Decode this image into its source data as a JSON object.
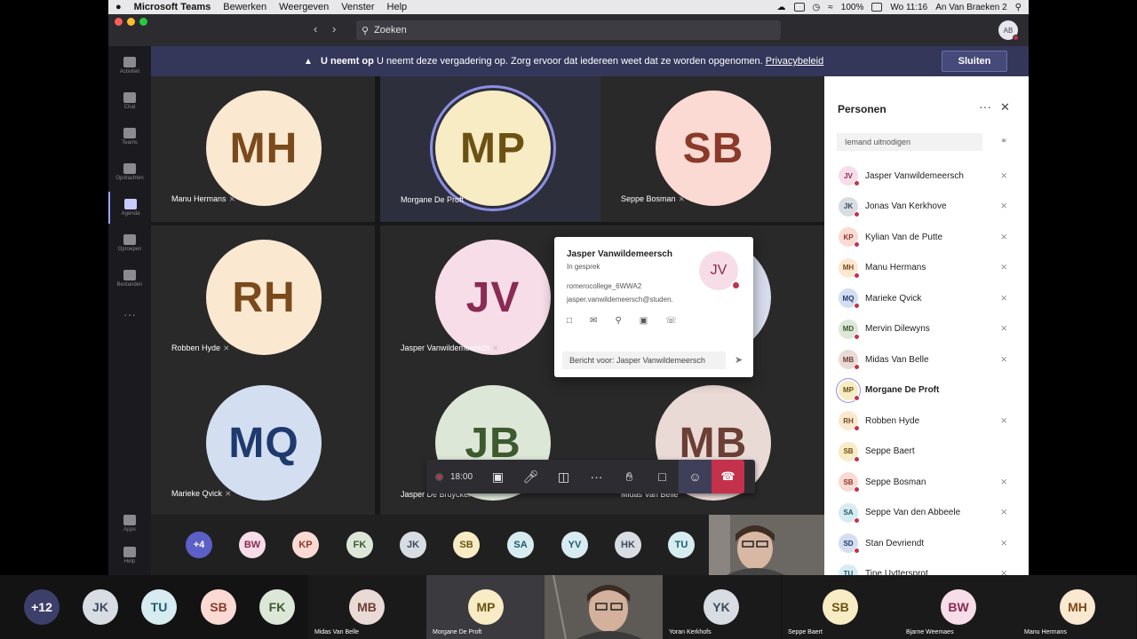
{
  "menubar": {
    "app": "Microsoft Teams",
    "menus": [
      "Bewerken",
      "Weergeven",
      "Venster",
      "Help"
    ],
    "battery": "100%",
    "clock": "Wo 11:16",
    "user": "An Van Braeken 2"
  },
  "titlebar": {
    "search_placeholder": "Zoeken",
    "me_initials": "AB"
  },
  "rail": [
    {
      "label": "Activiteit",
      "icon": "bell-icon"
    },
    {
      "label": "Chat",
      "icon": "chat-icon"
    },
    {
      "label": "Teams",
      "icon": "teams-icon"
    },
    {
      "label": "Opdrachten",
      "icon": "assignments-icon"
    },
    {
      "label": "Agenda",
      "icon": "calendar-icon"
    },
    {
      "label": "Oproepen",
      "icon": "phone-icon"
    },
    {
      "label": "Bestanden",
      "icon": "files-icon"
    },
    {
      "label": "Apps",
      "icon": "apps-icon"
    },
    {
      "label": "Help",
      "icon": "help-icon"
    }
  ],
  "banner": {
    "bold": "U neemt op",
    "text": "U neemt deze vergadering op. Zorg ervoor dat iedereen weet dat ze worden opgenomen.",
    "link": "Privacybeleid",
    "button": "Sluiten"
  },
  "grid": [
    {
      "initials": "MH",
      "name": "Manu Hermans",
      "bg": "#fbe8d0",
      "fg": "#7a4a1c"
    },
    {
      "initials": "MP",
      "name": "Morgane De Proft",
      "bg": "#f7ecc4",
      "fg": "#6b5213"
    },
    {
      "initials": "SB",
      "name": "Seppe Bosman",
      "bg": "#fadad2",
      "fg": "#8a3a2a"
    },
    {
      "initials": "RH",
      "name": "Robben Hyde",
      "bg": "#fbe8d0",
      "fg": "#7a4a1c"
    },
    {
      "initials": "JV",
      "name": "Jasper Vanwildemeersch",
      "bg": "#f6dde8",
      "fg": "#8a2a55"
    },
    {
      "initials": "",
      "name": "",
      "bg": "#d8dbeb",
      "fg": "#333"
    },
    {
      "initials": "MQ",
      "name": "Marieke Qvick",
      "bg": "#d3dff1",
      "fg": "#1e3a6e"
    },
    {
      "initials": "JB",
      "name": "Jasper De Bruycker",
      "bg": "#dde7d8",
      "fg": "#3d5a2e"
    },
    {
      "initials": "MB",
      "name": "Midas Van Belle",
      "bg": "#eadad6",
      "fg": "#6b3f35"
    }
  ],
  "strip": [
    {
      "initials": "+4",
      "bg": "#5b5fc7",
      "fg": "#ffffff"
    },
    {
      "initials": "BW",
      "bg": "#f6dde8",
      "fg": "#8a2a55"
    },
    {
      "initials": "KP",
      "bg": "#fadad2",
      "fg": "#8a3a2a"
    },
    {
      "initials": "FK",
      "bg": "#dde7d8",
      "fg": "#3d5a2e"
    },
    {
      "initials": "JK",
      "bg": "#d8dce3",
      "fg": "#3b4b5e"
    },
    {
      "initials": "SB",
      "bg": "#f7ecc4",
      "fg": "#6b5213"
    },
    {
      "initials": "SA",
      "bg": "#d6ecf1",
      "fg": "#1e5a6b"
    },
    {
      "initials": "YV",
      "bg": "#d6ecf1",
      "fg": "#1e5a6b"
    },
    {
      "initials": "HK",
      "bg": "#d8dce3",
      "fg": "#3b4b5e"
    },
    {
      "initials": "TU",
      "bg": "#d6ecf1",
      "fg": "#1e5a6b"
    }
  ],
  "controls": {
    "timer": "18:00"
  },
  "card": {
    "name": "Jasper Vanwildemeersch",
    "status": "In gesprek",
    "org": "romerocollege_6WWA2",
    "email": "jasper.vanwildemeersch@studen.",
    "initials": "JV",
    "message_placeholder": "Bericht voor: Jasper Vanwildemeersch"
  },
  "panel": {
    "title": "Personen",
    "invite_placeholder": "Iemand uitnodigen",
    "people": [
      {
        "initials": "JV",
        "name": "Jasper Vanwildemeersch",
        "bg": "#f6dde8",
        "fg": "#8a2a55",
        "muted": true,
        "bold": false
      },
      {
        "initials": "JK",
        "name": "Jonas Van Kerkhove",
        "bg": "#d8dce3",
        "fg": "#3b4b5e",
        "muted": true,
        "bold": false
      },
      {
        "initials": "KP",
        "name": "Kylian Van de Putte",
        "bg": "#fadad2",
        "fg": "#8a3a2a",
        "muted": true,
        "bold": false
      },
      {
        "initials": "MH",
        "name": "Manu Hermans",
        "bg": "#fbe8d0",
        "fg": "#7a4a1c",
        "muted": true,
        "bold": false
      },
      {
        "initials": "MQ",
        "name": "Marieke Qvick",
        "bg": "#d3dff1",
        "fg": "#1e3a6e",
        "muted": true,
        "bold": false
      },
      {
        "initials": "MD",
        "name": "Mervin Dilewyns",
        "bg": "#dde7d8",
        "fg": "#3d5a2e",
        "muted": true,
        "bold": false
      },
      {
        "initials": "MB",
        "name": "Midas Van Belle",
        "bg": "#eadad6",
        "fg": "#6b3f35",
        "muted": true,
        "bold": false
      },
      {
        "initials": "MP",
        "name": "Morgane De Proft",
        "bg": "#f7ecc4",
        "fg": "#6b5213",
        "muted": false,
        "bold": true
      },
      {
        "initials": "RH",
        "name": "Robben Hyde",
        "bg": "#fbe8d0",
        "fg": "#7a4a1c",
        "muted": true,
        "bold": false
      },
      {
        "initials": "SB",
        "name": "Seppe Baert",
        "bg": "#f7ecc4",
        "fg": "#6b5213",
        "muted": false,
        "bold": false
      },
      {
        "initials": "SB",
        "name": "Seppe Bosman",
        "bg": "#fadad2",
        "fg": "#8a3a2a",
        "muted": true,
        "bold": false
      },
      {
        "initials": "SA",
        "name": "Seppe Van den Abbeele",
        "bg": "#d6ecf1",
        "fg": "#1e5a6b",
        "muted": true,
        "bold": false
      },
      {
        "initials": "SD",
        "name": "Stan Devriendt",
        "bg": "#d3dff1",
        "fg": "#1e3a6e",
        "muted": true,
        "bold": false
      },
      {
        "initials": "TU",
        "name": "Tine Uyttersprot",
        "bg": "#d6ecf1",
        "fg": "#1e5a6b",
        "muted": true,
        "bold": false
      }
    ]
  },
  "bottom": [
    {
      "initials": "+12",
      "name": "",
      "bg": "#3d3f6b",
      "fg": "#ffffff"
    },
    {
      "initials": "JK",
      "name": "",
      "bg": "#d8dce3",
      "fg": "#3b4b5e"
    },
    {
      "initials": "TU",
      "name": "",
      "bg": "#d6ecf1",
      "fg": "#1e5a6b"
    },
    {
      "initials": "SB",
      "name": "",
      "bg": "#fadad2",
      "fg": "#8a3a2a"
    },
    {
      "initials": "FK",
      "name": "",
      "bg": "#dde7d8",
      "fg": "#3d5a2e"
    },
    {
      "initials": "MB",
      "name": "Midas Van Belle",
      "bg": "#eadad6",
      "fg": "#6b3f35"
    },
    {
      "initials": "MP",
      "name": "Morgane De Proft",
      "bg": "#f7ecc4",
      "fg": "#6b5213"
    },
    {
      "initials": "",
      "name": "",
      "bg": "",
      "fg": ""
    },
    {
      "initials": "YK",
      "name": "Yoran Kerkhofs",
      "bg": "#d8dce3",
      "fg": "#3b4b5e"
    },
    {
      "initials": "SB",
      "name": "Seppe Baert",
      "bg": "#f7ecc4",
      "fg": "#6b5213"
    },
    {
      "initials": "BW",
      "name": "Bjarne Weemaes",
      "bg": "#f6dde8",
      "fg": "#8a2a55"
    },
    {
      "initials": "MH",
      "name": "Manu Hermans",
      "bg": "#fbe8d0",
      "fg": "#7a4a1c"
    }
  ]
}
